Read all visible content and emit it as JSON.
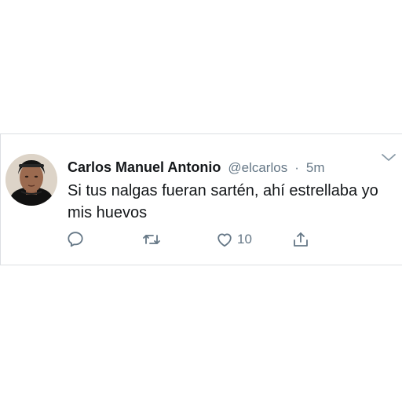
{
  "tweet": {
    "display_name": "Carlos Manuel Antonio",
    "handle": "@elcarlos",
    "separator": "·",
    "time": "5m",
    "text": "Si tus nalgas fueran sartén, ahí estrellaba yo mis huevos",
    "avatar_icon": "profile-photo",
    "menu_icon": "chevron-down-icon"
  },
  "actions": {
    "reply_icon": "reply-icon",
    "retweet_icon": "retweet-icon",
    "like_icon": "heart-icon",
    "like_count": "10",
    "share_icon": "share-icon"
  },
  "colors": {
    "text": "#14171a",
    "secondary": "#657786",
    "border": "#dcdfe3"
  }
}
